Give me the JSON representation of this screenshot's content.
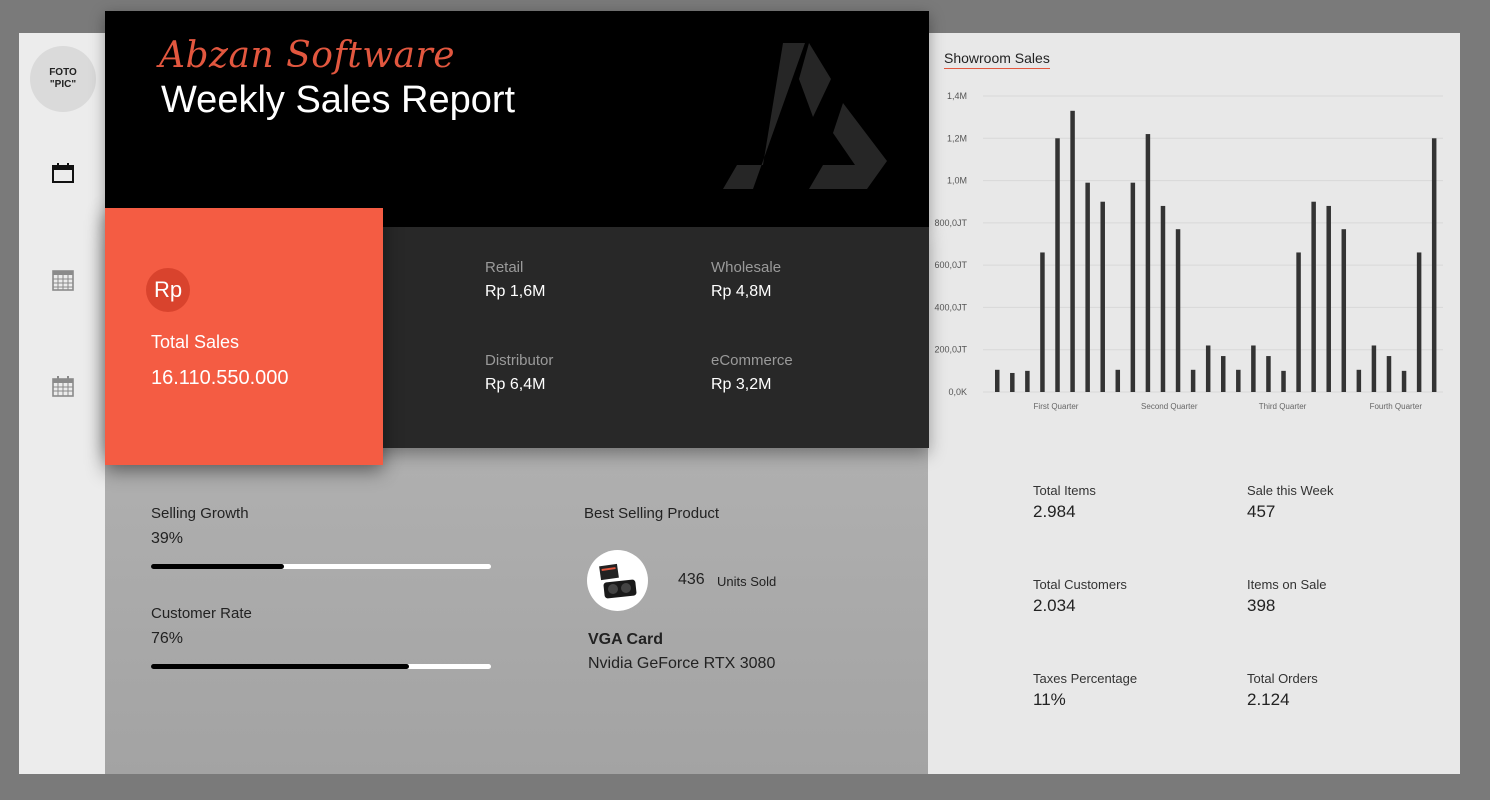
{
  "sidebar": {
    "avatar_text": "FOTO\n\"PIC\"",
    "icons": [
      "calendar-icon",
      "grid-calendar-icon",
      "calendar-table-icon"
    ]
  },
  "header": {
    "brand": "Abzan Software",
    "title": "Weekly Sales Report"
  },
  "total_sales": {
    "currency_symbol": "Rp",
    "label": "Total Sales",
    "value": "16.110.550.000"
  },
  "channels": [
    {
      "label": "Retail",
      "value": "Rp 1,6M"
    },
    {
      "label": "Wholesale",
      "value": "Rp 4,8M"
    },
    {
      "label": "Distributor",
      "value": "Rp 6,4M"
    },
    {
      "label": "eCommerce",
      "value": "Rp 3,2M"
    }
  ],
  "growth": {
    "selling": {
      "label": "Selling Growth",
      "value": "39%",
      "fraction": 0.39
    },
    "customer": {
      "label": "Customer Rate",
      "value": "76%",
      "fraction": 0.76
    }
  },
  "best_product": {
    "title": "Best Selling Product",
    "units": "436",
    "units_label": "Units Sold",
    "category": "VGA Card",
    "name": "Nvidia GeForce RTX 3080"
  },
  "showroom": {
    "title": "Showroom Sales",
    "stats": [
      {
        "label": "Total Items",
        "value": "2.984"
      },
      {
        "label": "Sale this Week",
        "value": "457"
      },
      {
        "label": "Total Customers",
        "value": "2.034"
      },
      {
        "label": "Items on Sale",
        "value": "398"
      },
      {
        "label": "Taxes Percentage",
        "value": "11%"
      },
      {
        "label": "Total Orders",
        "value": "2.124"
      }
    ]
  },
  "chart_data": {
    "type": "bar",
    "title": "Showroom Sales",
    "xlabel": "",
    "ylabel": "",
    "ylim": [
      0,
      1400000
    ],
    "yticks": [
      0,
      200000,
      400000,
      600000,
      800000,
      1000000,
      1200000,
      1400000
    ],
    "ytick_labels": [
      "0,0K",
      "200,0JT",
      "400,0JT",
      "600,0JT",
      "800,0JT",
      "1,0M",
      "1,2M",
      "1,4M"
    ],
    "groups": [
      "First Quarter",
      "Second Quarter",
      "Third Quarter",
      "Fourth Quarter"
    ],
    "grid": true,
    "color": "#333333",
    "values": [
      105000,
      90000,
      100000,
      660000,
      1200000,
      1330000,
      990000,
      900000,
      105000,
      990000,
      1220000,
      880000,
      770000,
      105000,
      220000,
      170000,
      105000,
      220000,
      170000,
      100000,
      660000,
      900000,
      880000,
      770000,
      105000,
      220000,
      170000,
      100000,
      660000,
      1200000
    ]
  }
}
